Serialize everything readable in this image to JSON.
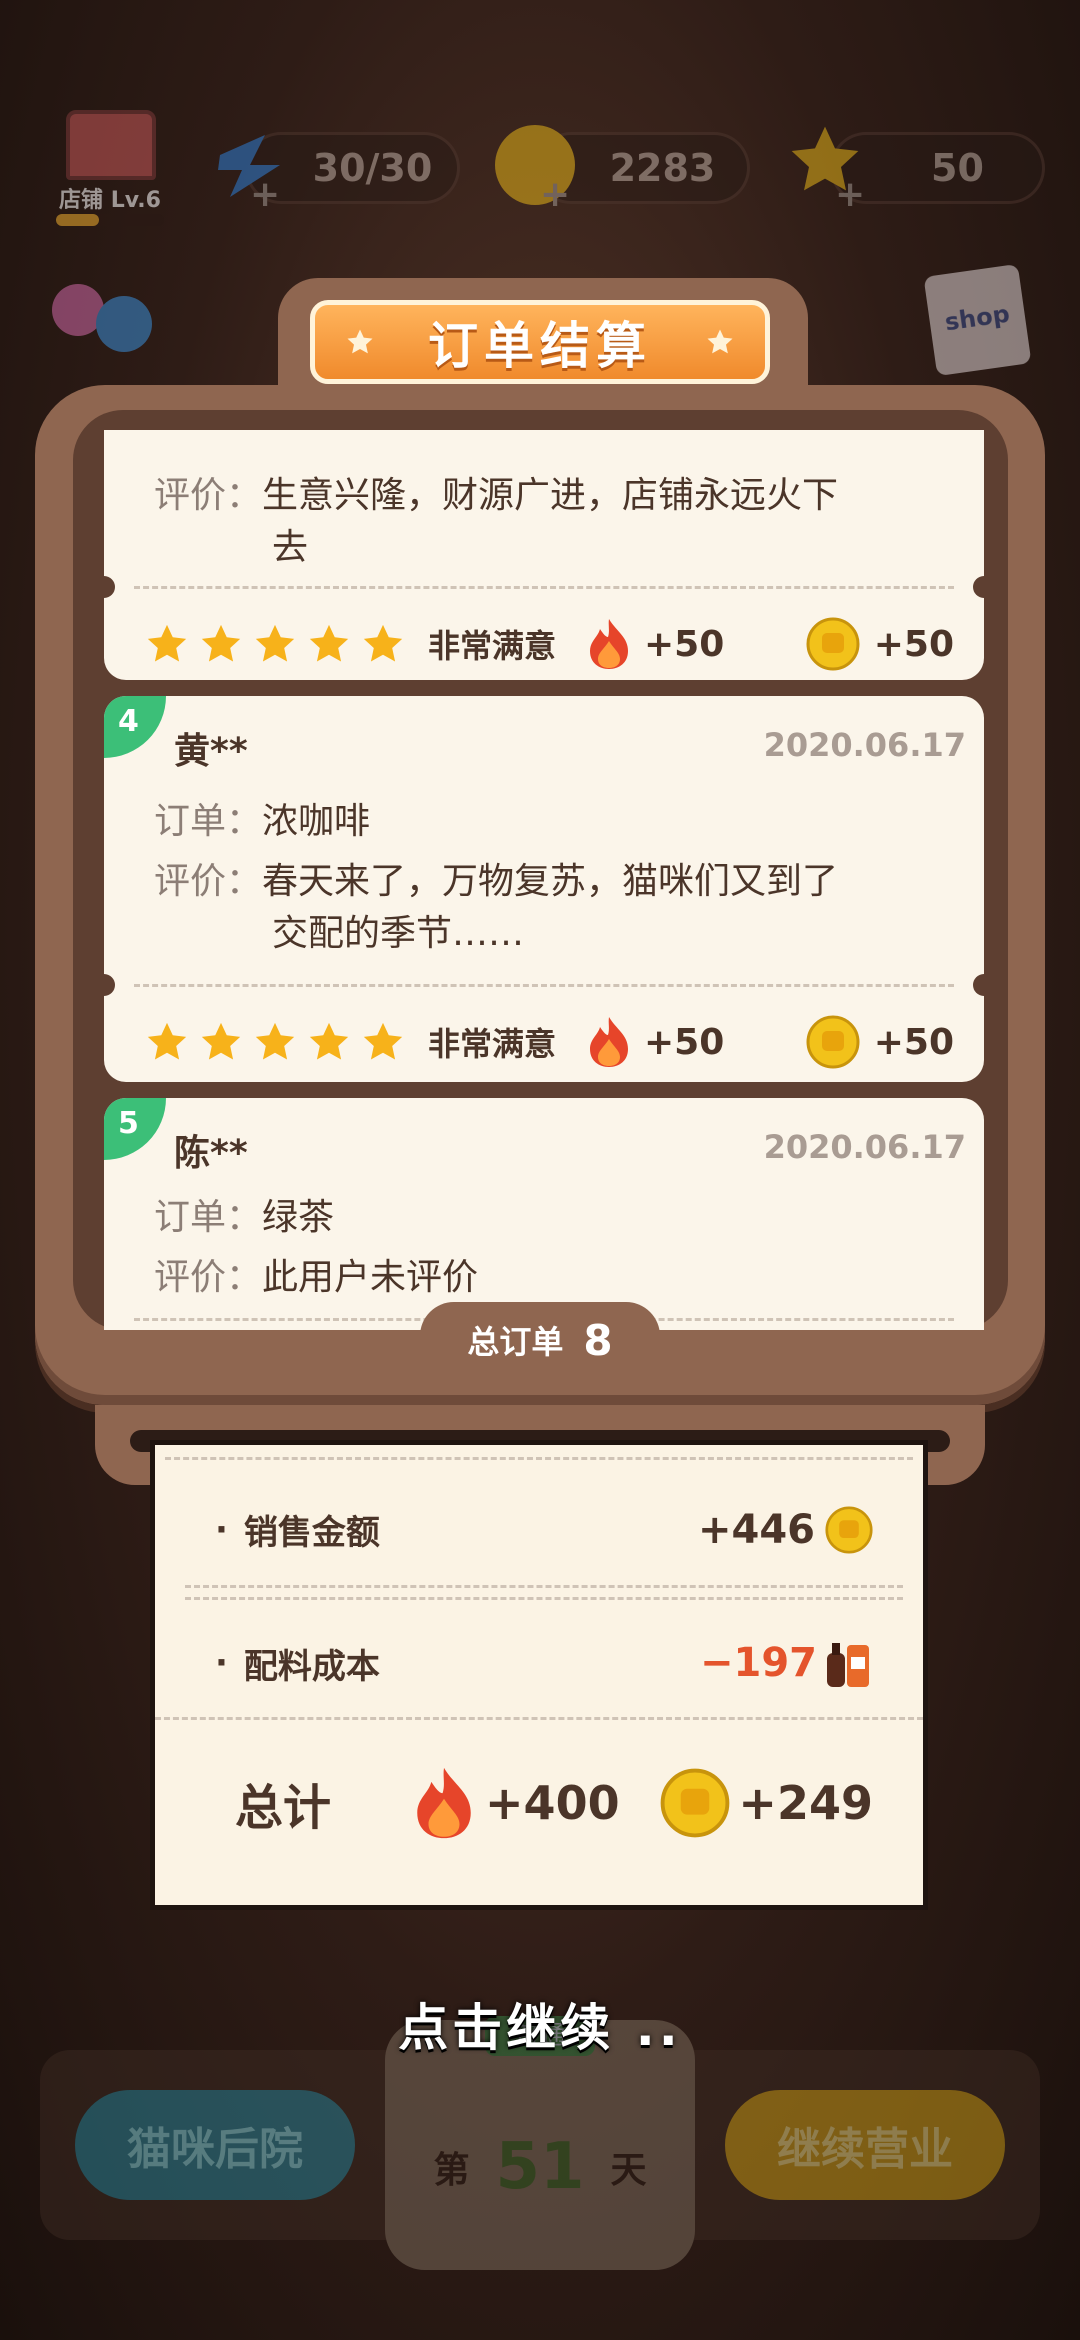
{
  "hud": {
    "shop_label": "店铺 Lv.6",
    "energy": "30/30",
    "coins": "2283",
    "stars": "50"
  },
  "shop_bag_label": "shop",
  "title": "订单结算",
  "orders": [
    {
      "review_label": "评价：",
      "review_line1": "生意兴隆，财源广进，店铺永远火下",
      "review_line2": "去",
      "satisfaction": "非常满意",
      "fire_reward": "+50",
      "coin_reward": "+50"
    },
    {
      "index": "4",
      "name": "黄**",
      "date": "2020.06.17",
      "order_label": "订单：",
      "order_item": "浓咖啡",
      "review_label": "评价：",
      "review_line1": "春天来了，万物复苏，猫咪们又到了",
      "review_line2": "交配的季节……",
      "satisfaction": "非常满意",
      "fire_reward": "+50",
      "coin_reward": "+50"
    },
    {
      "index": "5",
      "name": "陈**",
      "date": "2020.06.17",
      "order_label": "订单：",
      "order_item": "绿茶",
      "review_label": "评价：",
      "review_line1": "此用户未评价"
    }
  ],
  "total_orders_label": "总订单",
  "total_orders": "8",
  "receipt": {
    "sales_label": "销售金额",
    "sales_value": "+446",
    "cost_label": "配料成本",
    "cost_value": "−197",
    "total_label": "总计",
    "total_fire": "+400",
    "total_coins": "+249"
  },
  "continue_hint": "点击继续 ..",
  "bottom": {
    "left_button": "猫咪后院",
    "day_prefix": "第",
    "day_number": "51",
    "day_suffix": "天",
    "day_tag": "普通",
    "right_button": "继续营业"
  },
  "colors": {
    "accent_orange": "#f08a2c",
    "panel_brown": "#8f6650",
    "badge_green": "#3cbf78",
    "cost_red": "#e4542c"
  }
}
